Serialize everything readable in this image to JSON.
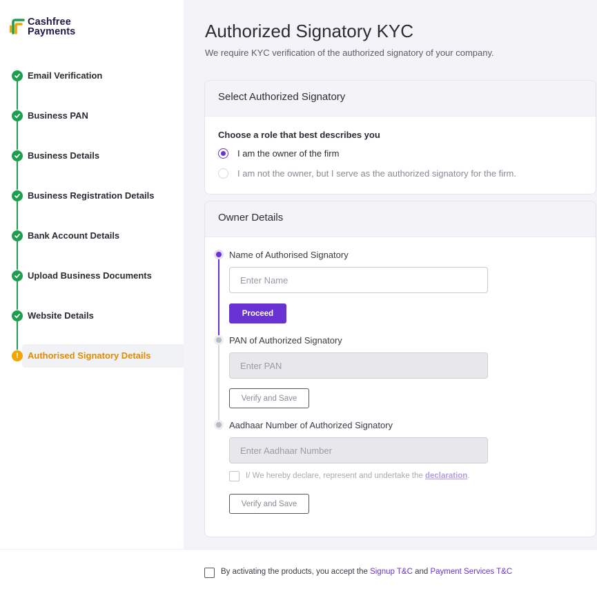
{
  "brand": {
    "line1": "Cashfree",
    "line2": "Payments",
    "colors": {
      "green": "#1e9e4f",
      "yellow": "#f0a500",
      "purple": "#6933d3"
    }
  },
  "steps": [
    {
      "label": "Email Verification",
      "status": "done"
    },
    {
      "label": "Business PAN",
      "status": "done"
    },
    {
      "label": "Business Details",
      "status": "done"
    },
    {
      "label": "Business Registration Details",
      "status": "done"
    },
    {
      "label": "Bank Account Details",
      "status": "done"
    },
    {
      "label": "Upload Business Documents",
      "status": "done"
    },
    {
      "label": "Website Details",
      "status": "done"
    },
    {
      "label": "Authorised Signatory Details",
      "status": "pending",
      "icon": "!"
    }
  ],
  "page": {
    "title": "Authorized Signatory KYC",
    "subtitle": "We require KYC verification of the authorized signatory of your company."
  },
  "select_card": {
    "heading": "Select Authorized Signatory",
    "question": "Choose a role that best describes you",
    "options": [
      {
        "label": "I am the owner of the firm",
        "selected": true
      },
      {
        "label": "I am not the owner, but I serve as the authorized signatory for the firm.",
        "selected": false
      }
    ]
  },
  "owner_card": {
    "heading": "Owner Details",
    "name": {
      "label": "Name of Authorised Signatory",
      "value": "",
      "placeholder": "Enter Name",
      "button": "Proceed"
    },
    "pan": {
      "label": "PAN of Authorized Signatory",
      "value": "",
      "placeholder": "Enter PAN",
      "button": "Verify and Save"
    },
    "aadhaar": {
      "label": "Aadhaar Number of Authorized Signatory",
      "value": "",
      "placeholder": "Enter Aadhaar Number",
      "declaration_prefix": "I/ We hereby declare, represent and undertake the",
      "declaration_link": "declaration",
      "declaration_suffix": ".",
      "button": "Verify and Save"
    }
  },
  "footer": {
    "prefix": "By activating the products, you accept the",
    "link1": "Signup T&C",
    "and": "and",
    "link2": "Payment Services T&C"
  }
}
